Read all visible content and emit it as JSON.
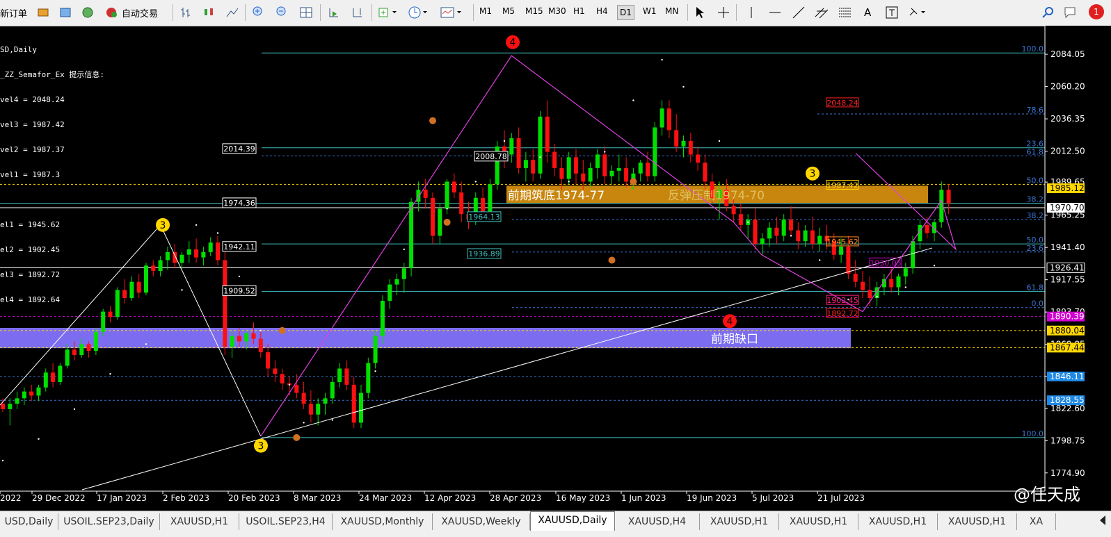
{
  "toolbar": {
    "new_order": "新订单",
    "auto_trade": "自动交易",
    "timeframes": [
      "M1",
      "M5",
      "M15",
      "M30",
      "H1",
      "H4",
      "D1",
      "W1",
      "MN"
    ],
    "active_timeframe": "D1",
    "notification_count": "1"
  },
  "indicator_info": {
    "symbol": "SD,Daily",
    "title": "_ZZ_Semafor_Ex 提示信息:",
    "lines": [
      "vel4 = 2048.24",
      "vel3 = 1987.42",
      "vel2 = 1987.37",
      "vel1 = 1987.3",
      "",
      "el1 = 1945.62",
      "el2 = 1902.45",
      "el3 = 1892.72",
      "el4 = 1892.64"
    ]
  },
  "annotations": {
    "support_zone": "前期筑底1974-77",
    "resistance_zone": "反弹压制1974-70",
    "gap_zone": "前期缺口"
  },
  "tabs": [
    "USD,Daily",
    "USOIL.SEP23,Daily",
    "XAUUSD,H1",
    "USOIL.SEP23,H4",
    "XAUUSD,Monthly",
    "XAUUSD,Weekly",
    "XAUUSD,Daily",
    "XAUUSD,H4",
    "XAUUSD,H1",
    "XAUUSD,H1",
    "XAUUSD,H1",
    "XAUUSD,H1",
    "XA"
  ],
  "active_tab": "XAUUSD,Daily",
  "watermark": "@任天成",
  "colors": {
    "bull": "#00e000",
    "bear": "#ff1010",
    "fib": "#40c0c0",
    "zigzag": "#e040e0",
    "gap": "#7b6cf0",
    "zone": "#c8860e"
  },
  "chart_data": {
    "type": "candlestick",
    "symbol": "XAUUSD",
    "timeframe": "Daily",
    "ylim": [
      1764,
      2100
    ],
    "y_ticks": [
      "2084.05",
      "2060.20",
      "2036.35",
      "2012.50",
      "1989.65",
      "1965.25",
      "1941.40",
      "1917.55",
      "1893.70",
      "1869.85",
      "1846.11",
      "1822.60",
      "1798.75",
      "1774.90"
    ],
    "x_ticks": [
      "2022",
      "29 Dec 2022",
      "17 Jan 2023",
      "2 Feb 2023",
      "20 Feb 2023",
      "8 Mar 2023",
      "24 Mar 2023",
      "12 Apr 2023",
      "28 Apr 2023",
      "16 May 2023",
      "1 Jun 2023",
      "19 Jun 2023",
      "5 Jul 2023",
      "21 Jul 2023"
    ],
    "price_tags": [
      {
        "price": "1985.12",
        "color": "#ffd700",
        "text": "#000"
      },
      {
        "price": "1970.70",
        "color": "#ffffff",
        "text": "#000"
      },
      {
        "price": "1926.41",
        "color": "#000000",
        "text": "#fff"
      },
      {
        "price": "1890.39",
        "color": "#d000d0",
        "text": "#fff"
      },
      {
        "price": "1880.04",
        "color": "#ffd700",
        "text": "#000"
      },
      {
        "price": "1867.44",
        "color": "#ffd700",
        "text": "#000"
      },
      {
        "price": "1846.11",
        "color": "#1e88e5",
        "text": "#fff"
      },
      {
        "price": "1828.55",
        "color": "#1e88e5",
        "text": "#fff"
      }
    ],
    "level_labels": [
      "2014.39",
      "1974.36",
      "1942.11",
      "1909.52",
      "2008.78",
      "1964.13",
      "1936.89"
    ],
    "fib_labels": [
      {
        "text": "100.0",
        "y": 2085
      },
      {
        "text": "78.6",
        "y": 2040
      },
      {
        "text": "23.6",
        "y": 2015
      },
      {
        "text": "61.8",
        "y": 2009
      },
      {
        "text": "50.0",
        "y": 1988
      },
      {
        "text": "38.2",
        "y": 1974
      },
      {
        "text": "38.2",
        "y": 1962
      },
      {
        "text": "50.0",
        "y": 1944
      },
      {
        "text": "23.6",
        "y": 1938
      },
      {
        "text": "61.8",
        "y": 1909
      },
      {
        "text": "0.0",
        "y": 1897
      },
      {
        "text": "100.0",
        "y": 1801
      }
    ],
    "semafor_levels": [
      {
        "text": "2048.24",
        "color": "#ff2020",
        "y": 2048.24
      },
      {
        "text": "1987.42",
        "color": "#ffd700",
        "y": 1987.42
      },
      {
        "text": "1945.62",
        "color": "#ff8c20",
        "y": 1945.62
      },
      {
        "text": "1930.05",
        "color": "#d000d0",
        "y": 1930.05
      },
      {
        "text": "1902.45",
        "color": "#ff2080",
        "y": 1902.45
      },
      {
        "text": "1892.72",
        "color": "#ff2020",
        "y": 1892.72
      }
    ],
    "markers": [
      {
        "label": "4",
        "color": "#ff1010",
        "x": 737,
        "price": 2093
      },
      {
        "label": "3",
        "color": "#ffd700",
        "x": 234,
        "price": 1958
      },
      {
        "label": "3",
        "color": "#ffd700",
        "x": 375,
        "price": 1795
      },
      {
        "label": "4",
        "color": "#ff1010",
        "x": 1049,
        "price": 1887
      },
      {
        "label": "3",
        "color": "#ffd700",
        "x": 1168,
        "price": 1996
      }
    ],
    "candles": [
      [
        0,
        1826,
        1830,
        1820,
        1822
      ],
      [
        1,
        1822,
        1830,
        1810,
        1826
      ],
      [
        2,
        1826,
        1835,
        1822,
        1830
      ],
      [
        3,
        1830,
        1838,
        1825,
        1835
      ],
      [
        4,
        1835,
        1840,
        1828,
        1832
      ],
      [
        5,
        1832,
        1840,
        1828,
        1838
      ],
      [
        6,
        1838,
        1852,
        1835,
        1849
      ],
      [
        7,
        1849,
        1856,
        1838,
        1842
      ],
      [
        8,
        1842,
        1856,
        1840,
        1854
      ],
      [
        9,
        1854,
        1870,
        1852,
        1866
      ],
      [
        10,
        1866,
        1872,
        1858,
        1862
      ],
      [
        11,
        1862,
        1874,
        1860,
        1870
      ],
      [
        12,
        1870,
        1872,
        1860,
        1865
      ],
      [
        13,
        1865,
        1882,
        1862,
        1879
      ],
      [
        14,
        1879,
        1896,
        1876,
        1894
      ],
      [
        15,
        1894,
        1898,
        1886,
        1890
      ],
      [
        16,
        1890,
        1912,
        1888,
        1910
      ],
      [
        17,
        1910,
        1918,
        1900,
        1904
      ],
      [
        18,
        1904,
        1920,
        1902,
        1916
      ],
      [
        19,
        1916,
        1922,
        1904,
        1908
      ],
      [
        20,
        1908,
        1930,
        1906,
        1928
      ],
      [
        21,
        1928,
        1932,
        1920,
        1924
      ],
      [
        22,
        1924,
        1935,
        1920,
        1932
      ],
      [
        23,
        1932,
        1942,
        1925,
        1938
      ],
      [
        24,
        1938,
        1944,
        1926,
        1930
      ],
      [
        25,
        1930,
        1938,
        1926,
        1936
      ],
      [
        26,
        1936,
        1946,
        1930,
        1940
      ],
      [
        27,
        1940,
        1948,
        1930,
        1934
      ],
      [
        28,
        1934,
        1942,
        1928,
        1938
      ],
      [
        29,
        1938,
        1949,
        1935,
        1945
      ],
      [
        30,
        1945,
        1950,
        1928,
        1932
      ],
      [
        31,
        1932,
        1940,
        1862,
        1868
      ],
      [
        32,
        1868,
        1880,
        1860,
        1876
      ],
      [
        33,
        1876,
        1882,
        1868,
        1872
      ],
      [
        34,
        1872,
        1880,
        1866,
        1878
      ],
      [
        35,
        1878,
        1886,
        1870,
        1874
      ],
      [
        36,
        1874,
        1880,
        1860,
        1864
      ],
      [
        37,
        1864,
        1870,
        1846,
        1852
      ],
      [
        38,
        1852,
        1858,
        1842,
        1848
      ],
      [
        39,
        1848,
        1852,
        1836,
        1841
      ],
      [
        40,
        1841,
        1846,
        1832,
        1840
      ],
      [
        41,
        1840,
        1848,
        1830,
        1834
      ],
      [
        42,
        1834,
        1842,
        1822,
        1826
      ],
      [
        43,
        1826,
        1836,
        1812,
        1818
      ],
      [
        44,
        1818,
        1830,
        1810,
        1826
      ],
      [
        45,
        1826,
        1834,
        1818,
        1830
      ],
      [
        46,
        1830,
        1846,
        1826,
        1842
      ],
      [
        47,
        1842,
        1856,
        1838,
        1852
      ],
      [
        48,
        1852,
        1858,
        1836,
        1840
      ],
      [
        49,
        1840,
        1846,
        1808,
        1812
      ],
      [
        50,
        1812,
        1840,
        1808,
        1834
      ],
      [
        51,
        1834,
        1860,
        1830,
        1856
      ],
      [
        52,
        1856,
        1880,
        1852,
        1876
      ],
      [
        53,
        1876,
        1906,
        1870,
        1902
      ],
      [
        54,
        1902,
        1918,
        1896,
        1914
      ],
      [
        55,
        1914,
        1922,
        1906,
        1918
      ],
      [
        56,
        1918,
        1930,
        1908,
        1926
      ],
      [
        57,
        1926,
        1978,
        1920,
        1975
      ],
      [
        58,
        1975,
        1990,
        1968,
        1984
      ],
      [
        59,
        1984,
        1992,
        1970,
        1978
      ],
      [
        60,
        1978,
        1982,
        1944,
        1950
      ],
      [
        61,
        1950,
        1974,
        1944,
        1970
      ],
      [
        62,
        1970,
        1992,
        1966,
        1990
      ],
      [
        63,
        1990,
        1996,
        1978,
        1982
      ],
      [
        64,
        1982,
        1990,
        1960,
        1966
      ],
      [
        65,
        1966,
        1975,
        1955,
        1962
      ],
      [
        66,
        1962,
        1982,
        1958,
        1978
      ],
      [
        67,
        1978,
        1986,
        1962,
        1968
      ],
      [
        68,
        1968,
        1992,
        1964,
        1988
      ],
      [
        69,
        1988,
        2020,
        1984,
        2016
      ],
      [
        70,
        2016,
        2028,
        2000,
        2010
      ],
      [
        71,
        2010,
        2026,
        2004,
        2022
      ],
      [
        72,
        2022,
        2030,
        1996,
        2000
      ],
      [
        73,
        2000,
        2012,
        1990,
        2006
      ],
      [
        74,
        2006,
        2014,
        1990,
        1996
      ],
      [
        75,
        1996,
        2042,
        1992,
        2038
      ],
      [
        76,
        2038,
        2050,
        2004,
        2012
      ],
      [
        77,
        2012,
        2018,
        1994,
        2000
      ],
      [
        78,
        2000,
        2008,
        1984,
        1992
      ],
      [
        79,
        1992,
        2012,
        1988,
        2008
      ],
      [
        80,
        2008,
        2014,
        1988,
        1996
      ],
      [
        81,
        1996,
        2006,
        1984,
        1990
      ],
      [
        82,
        1990,
        2004,
        1986,
        2000
      ],
      [
        83,
        2000,
        2014,
        1992,
        2010
      ],
      [
        84,
        2010,
        2016,
        1988,
        1994
      ],
      [
        85,
        1994,
        2002,
        1988,
        1998
      ],
      [
        86,
        1998,
        2010,
        1990,
        2000
      ],
      [
        87,
        2000,
        2008,
        1986,
        1990
      ],
      [
        88,
        1990,
        2000,
        1984,
        1996
      ],
      [
        89,
        1996,
        2006,
        1990,
        2004
      ],
      [
        90,
        2004,
        2012,
        1990,
        1994
      ],
      [
        91,
        1994,
        2034,
        1990,
        2030
      ],
      [
        92,
        2030,
        2050,
        2024,
        2044
      ],
      [
        93,
        2044,
        2050,
        2022,
        2028
      ],
      [
        94,
        2028,
        2040,
        2012,
        2016
      ],
      [
        95,
        2016,
        2024,
        2008,
        2020
      ],
      [
        96,
        2020,
        2026,
        2004,
        2010
      ],
      [
        97,
        2010,
        2016,
        1998,
        2004
      ],
      [
        98,
        2004,
        2010,
        1984,
        1990
      ],
      [
        99,
        1990,
        1996,
        1974,
        1978
      ],
      [
        100,
        1978,
        1990,
        1962,
        1984
      ],
      [
        101,
        1984,
        1992,
        1968,
        1972
      ],
      [
        102,
        1972,
        1980,
        1960,
        1966
      ],
      [
        103,
        1966,
        1974,
        1954,
        1958
      ],
      [
        104,
        1958,
        1966,
        1948,
        1962
      ],
      [
        105,
        1962,
        1970,
        1940,
        1944
      ],
      [
        106,
        1944,
        1952,
        1936,
        1948
      ],
      [
        107,
        1948,
        1960,
        1942,
        1956
      ],
      [
        108,
        1956,
        1964,
        1944,
        1950
      ],
      [
        109,
        1950,
        1966,
        1946,
        1962
      ],
      [
        110,
        1962,
        1972,
        1950,
        1954
      ],
      [
        111,
        1954,
        1960,
        1940,
        1946
      ],
      [
        112,
        1946,
        1958,
        1942,
        1954
      ],
      [
        113,
        1954,
        1964,
        1940,
        1944
      ],
      [
        114,
        1944,
        1956,
        1938,
        1950
      ],
      [
        115,
        1950,
        1958,
        1940,
        1946
      ],
      [
        116,
        1946,
        1952,
        1932,
        1936
      ],
      [
        117,
        1936,
        1948,
        1930,
        1942
      ],
      [
        118,
        1942,
        1950,
        1918,
        1922
      ],
      [
        119,
        1922,
        1932,
        1912,
        1916
      ],
      [
        120,
        1916,
        1924,
        1904,
        1910
      ],
      [
        121,
        1910,
        1920,
        1898,
        1904
      ],
      [
        122,
        1904,
        1916,
        1898,
        1912
      ],
      [
        123,
        1912,
        1922,
        1906,
        1918
      ],
      [
        124,
        1918,
        1926,
        1908,
        1912
      ],
      [
        125,
        1912,
        1922,
        1906,
        1920
      ],
      [
        126,
        1920,
        1930,
        1914,
        1926
      ],
      [
        127,
        1926,
        1950,
        1922,
        1946
      ],
      [
        128,
        1946,
        1962,
        1940,
        1958
      ],
      [
        129,
        1958,
        1964,
        1948,
        1952
      ],
      [
        130,
        1952,
        1962,
        1946,
        1960
      ],
      [
        131,
        1960,
        1990,
        1956,
        1984
      ],
      [
        132,
        1984,
        1988,
        1966,
        1974
      ]
    ]
  }
}
